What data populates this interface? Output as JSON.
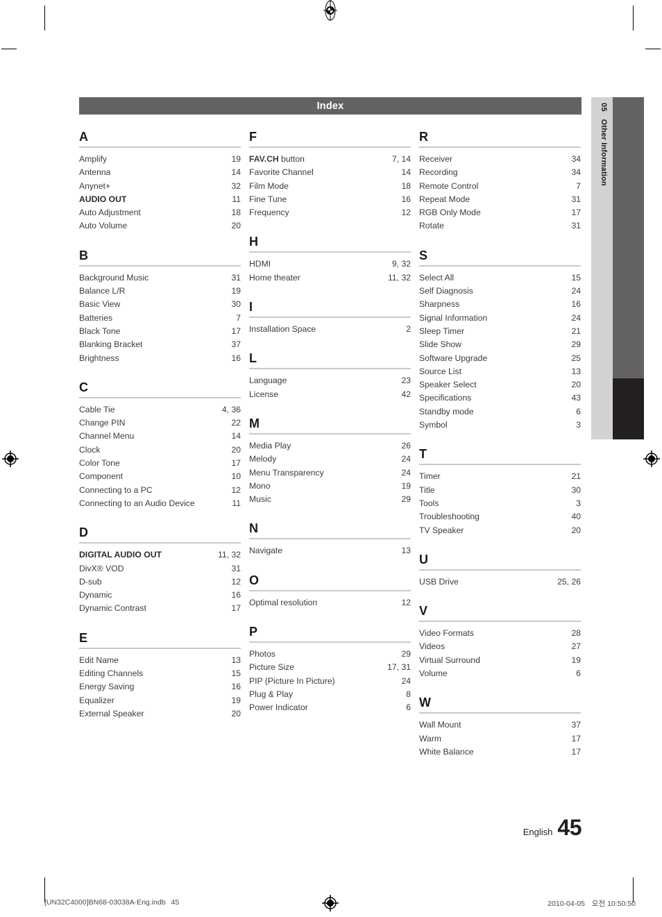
{
  "header": {
    "title": "Index"
  },
  "side_tab": {
    "number": "05",
    "label": "Other Information"
  },
  "page_number": {
    "language": "English",
    "number": "45"
  },
  "footer": {
    "left_file": "[UN32C4000]BN68-03038A-Eng.indb",
    "left_page": "45",
    "right_date": "2010-04-05",
    "right_time": "오전 10:50:50"
  },
  "colors": {
    "header_bar": "#656263",
    "tab_light": "#d2d2d2",
    "tab_mid": "#656263",
    "tab_dark": "#231f20",
    "rule": "#c9c9c9",
    "text": "#3b3b3b"
  },
  "columns": [
    {
      "groups": [
        {
          "letter": "A",
          "entries": [
            {
              "term": "Amplify",
              "pages": "19",
              "bold": false
            },
            {
              "term": "Antenna",
              "pages": "14",
              "bold": false
            },
            {
              "term": "Anynet+",
              "pages": "32",
              "bold": false
            },
            {
              "term": "AUDIO OUT",
              "pages": "11",
              "bold": true
            },
            {
              "term": "Auto Adjustment",
              "pages": "18",
              "bold": false
            },
            {
              "term": "Auto Volume",
              "pages": "20",
              "bold": false
            }
          ]
        },
        {
          "letter": "B",
          "entries": [
            {
              "term": "Background Music",
              "pages": "31",
              "bold": false
            },
            {
              "term": "Balance L/R",
              "pages": "19",
              "bold": false
            },
            {
              "term": "Basic View",
              "pages": "30",
              "bold": false
            },
            {
              "term": "Batteries",
              "pages": "7",
              "bold": false
            },
            {
              "term": "Black Tone",
              "pages": "17",
              "bold": false
            },
            {
              "term": "Blanking Bracket",
              "pages": "37",
              "bold": false
            },
            {
              "term": "Brightness",
              "pages": "16",
              "bold": false
            }
          ]
        },
        {
          "letter": "C",
          "entries": [
            {
              "term": "Cable Tie",
              "pages": "4, 36",
              "bold": false
            },
            {
              "term": "Change PIN",
              "pages": "22",
              "bold": false
            },
            {
              "term": "Channel Menu",
              "pages": "14",
              "bold": false
            },
            {
              "term": "Clock",
              "pages": "20",
              "bold": false
            },
            {
              "term": "Color Tone",
              "pages": "17",
              "bold": false
            },
            {
              "term": "Component",
              "pages": "10",
              "bold": false
            },
            {
              "term": "Connecting to a PC",
              "pages": "12",
              "bold": false
            },
            {
              "term": "Connecting to an Audio Device",
              "pages": "11",
              "bold": false
            }
          ]
        },
        {
          "letter": "D",
          "entries": [
            {
              "term": "DIGITAL AUDIO OUT",
              "pages": "11, 32",
              "bold": true
            },
            {
              "term": "DivX® VOD",
              "pages": "31",
              "bold": false
            },
            {
              "term": "D-sub",
              "pages": "12",
              "bold": false
            },
            {
              "term": "Dynamic",
              "pages": "16",
              "bold": false
            },
            {
              "term": "Dynamic Contrast",
              "pages": "17",
              "bold": false
            }
          ]
        },
        {
          "letter": "E",
          "entries": [
            {
              "term": "Edit Name",
              "pages": "13",
              "bold": false
            },
            {
              "term": "Editing Channels",
              "pages": "15",
              "bold": false
            },
            {
              "term": "Energy Saving",
              "pages": "16",
              "bold": false
            },
            {
              "term": "Equalizer",
              "pages": "19",
              "bold": false
            },
            {
              "term": "External Speaker",
              "pages": "20",
              "bold": false
            }
          ]
        }
      ]
    },
    {
      "groups": [
        {
          "letter": "F",
          "entries": [
            {
              "term": "FAV.CH button",
              "pages": "7, 14",
              "bold": false,
              "term_bold_prefix": "FAV.CH"
            },
            {
              "term": "Favorite Channel",
              "pages": "14",
              "bold": false
            },
            {
              "term": "Film Mode",
              "pages": "18",
              "bold": false
            },
            {
              "term": "Fine Tune",
              "pages": "16",
              "bold": false
            },
            {
              "term": "Frequency",
              "pages": "12",
              "bold": false
            }
          ]
        },
        {
          "letter": "H",
          "entries": [
            {
              "term": "HDMI",
              "pages": "9, 32",
              "bold": false
            },
            {
              "term": "Home theater",
              "pages": "11, 32",
              "bold": false
            }
          ]
        },
        {
          "letter": "I",
          "entries": [
            {
              "term": "Installation Space",
              "pages": "2",
              "bold": false
            }
          ]
        },
        {
          "letter": "L",
          "entries": [
            {
              "term": "Language",
              "pages": "23",
              "bold": false
            },
            {
              "term": "License",
              "pages": "42",
              "bold": false
            }
          ]
        },
        {
          "letter": "M",
          "entries": [
            {
              "term": "Media Play",
              "pages": "26",
              "bold": false
            },
            {
              "term": "Melody",
              "pages": "24",
              "bold": false
            },
            {
              "term": "Menu Transparency",
              "pages": "24",
              "bold": false
            },
            {
              "term": "Mono",
              "pages": "19",
              "bold": false
            },
            {
              "term": "Music",
              "pages": "29",
              "bold": false
            }
          ]
        },
        {
          "letter": "N",
          "entries": [
            {
              "term": "Navigate",
              "pages": "13",
              "bold": false
            }
          ]
        },
        {
          "letter": "O",
          "entries": [
            {
              "term": "Optimal resolution",
              "pages": "12",
              "bold": false
            }
          ]
        },
        {
          "letter": "P",
          "entries": [
            {
              "term": "Photos",
              "pages": "29",
              "bold": false
            },
            {
              "term": "Picture Size",
              "pages": "17, 31",
              "bold": false
            },
            {
              "term": "PIP (Picture In Picture)",
              "pages": "24",
              "bold": false
            },
            {
              "term": "Plug & Play",
              "pages": "8",
              "bold": false
            },
            {
              "term": "Power Indicator",
              "pages": "6",
              "bold": false
            }
          ]
        }
      ]
    },
    {
      "groups": [
        {
          "letter": "R",
          "entries": [
            {
              "term": "Receiver",
              "pages": "34",
              "bold": false
            },
            {
              "term": "Recording",
              "pages": "34",
              "bold": false
            },
            {
              "term": "Remote Control",
              "pages": "7",
              "bold": false
            },
            {
              "term": "Repeat Mode",
              "pages": "31",
              "bold": false
            },
            {
              "term": "RGB Only Mode",
              "pages": "17",
              "bold": false
            },
            {
              "term": "Rotate",
              "pages": "31",
              "bold": false
            }
          ]
        },
        {
          "letter": "S",
          "entries": [
            {
              "term": "Select All",
              "pages": "15",
              "bold": false
            },
            {
              "term": "Self Diagnosis",
              "pages": "24",
              "bold": false
            },
            {
              "term": "Sharpness",
              "pages": "16",
              "bold": false
            },
            {
              "term": "Signal Information",
              "pages": "24",
              "bold": false
            },
            {
              "term": "Sleep Timer",
              "pages": "21",
              "bold": false
            },
            {
              "term": "Slide Show",
              "pages": "29",
              "bold": false
            },
            {
              "term": "Software Upgrade",
              "pages": "25",
              "bold": false
            },
            {
              "term": "Source List",
              "pages": "13",
              "bold": false
            },
            {
              "term": "Speaker Select",
              "pages": "20",
              "bold": false
            },
            {
              "term": "Specifications",
              "pages": "43",
              "bold": false
            },
            {
              "term": "Standby mode",
              "pages": "6",
              "bold": false
            },
            {
              "term": "Symbol",
              "pages": "3",
              "bold": false
            }
          ]
        },
        {
          "letter": "T",
          "entries": [
            {
              "term": "Timer",
              "pages": "21",
              "bold": false
            },
            {
              "term": "Title",
              "pages": "30",
              "bold": false
            },
            {
              "term": "Tools",
              "pages": "3",
              "bold": false
            },
            {
              "term": "Troubleshooting",
              "pages": "40",
              "bold": false
            },
            {
              "term": "TV Speaker",
              "pages": "20",
              "bold": false
            }
          ]
        },
        {
          "letter": "U",
          "entries": [
            {
              "term": "USB Drive",
              "pages": "25, 26",
              "bold": false
            }
          ]
        },
        {
          "letter": "V",
          "entries": [
            {
              "term": "Video Formats",
              "pages": "28",
              "bold": false
            },
            {
              "term": "Videos",
              "pages": "27",
              "bold": false
            },
            {
              "term": "Virtual Surround",
              "pages": "19",
              "bold": false
            },
            {
              "term": "Volume",
              "pages": "6",
              "bold": false
            }
          ]
        },
        {
          "letter": "W",
          "entries": [
            {
              "term": "Wall Mount",
              "pages": "37",
              "bold": false
            },
            {
              "term": "Warm",
              "pages": "17",
              "bold": false
            },
            {
              "term": "White Balance",
              "pages": "17",
              "bold": false
            }
          ]
        }
      ]
    }
  ]
}
